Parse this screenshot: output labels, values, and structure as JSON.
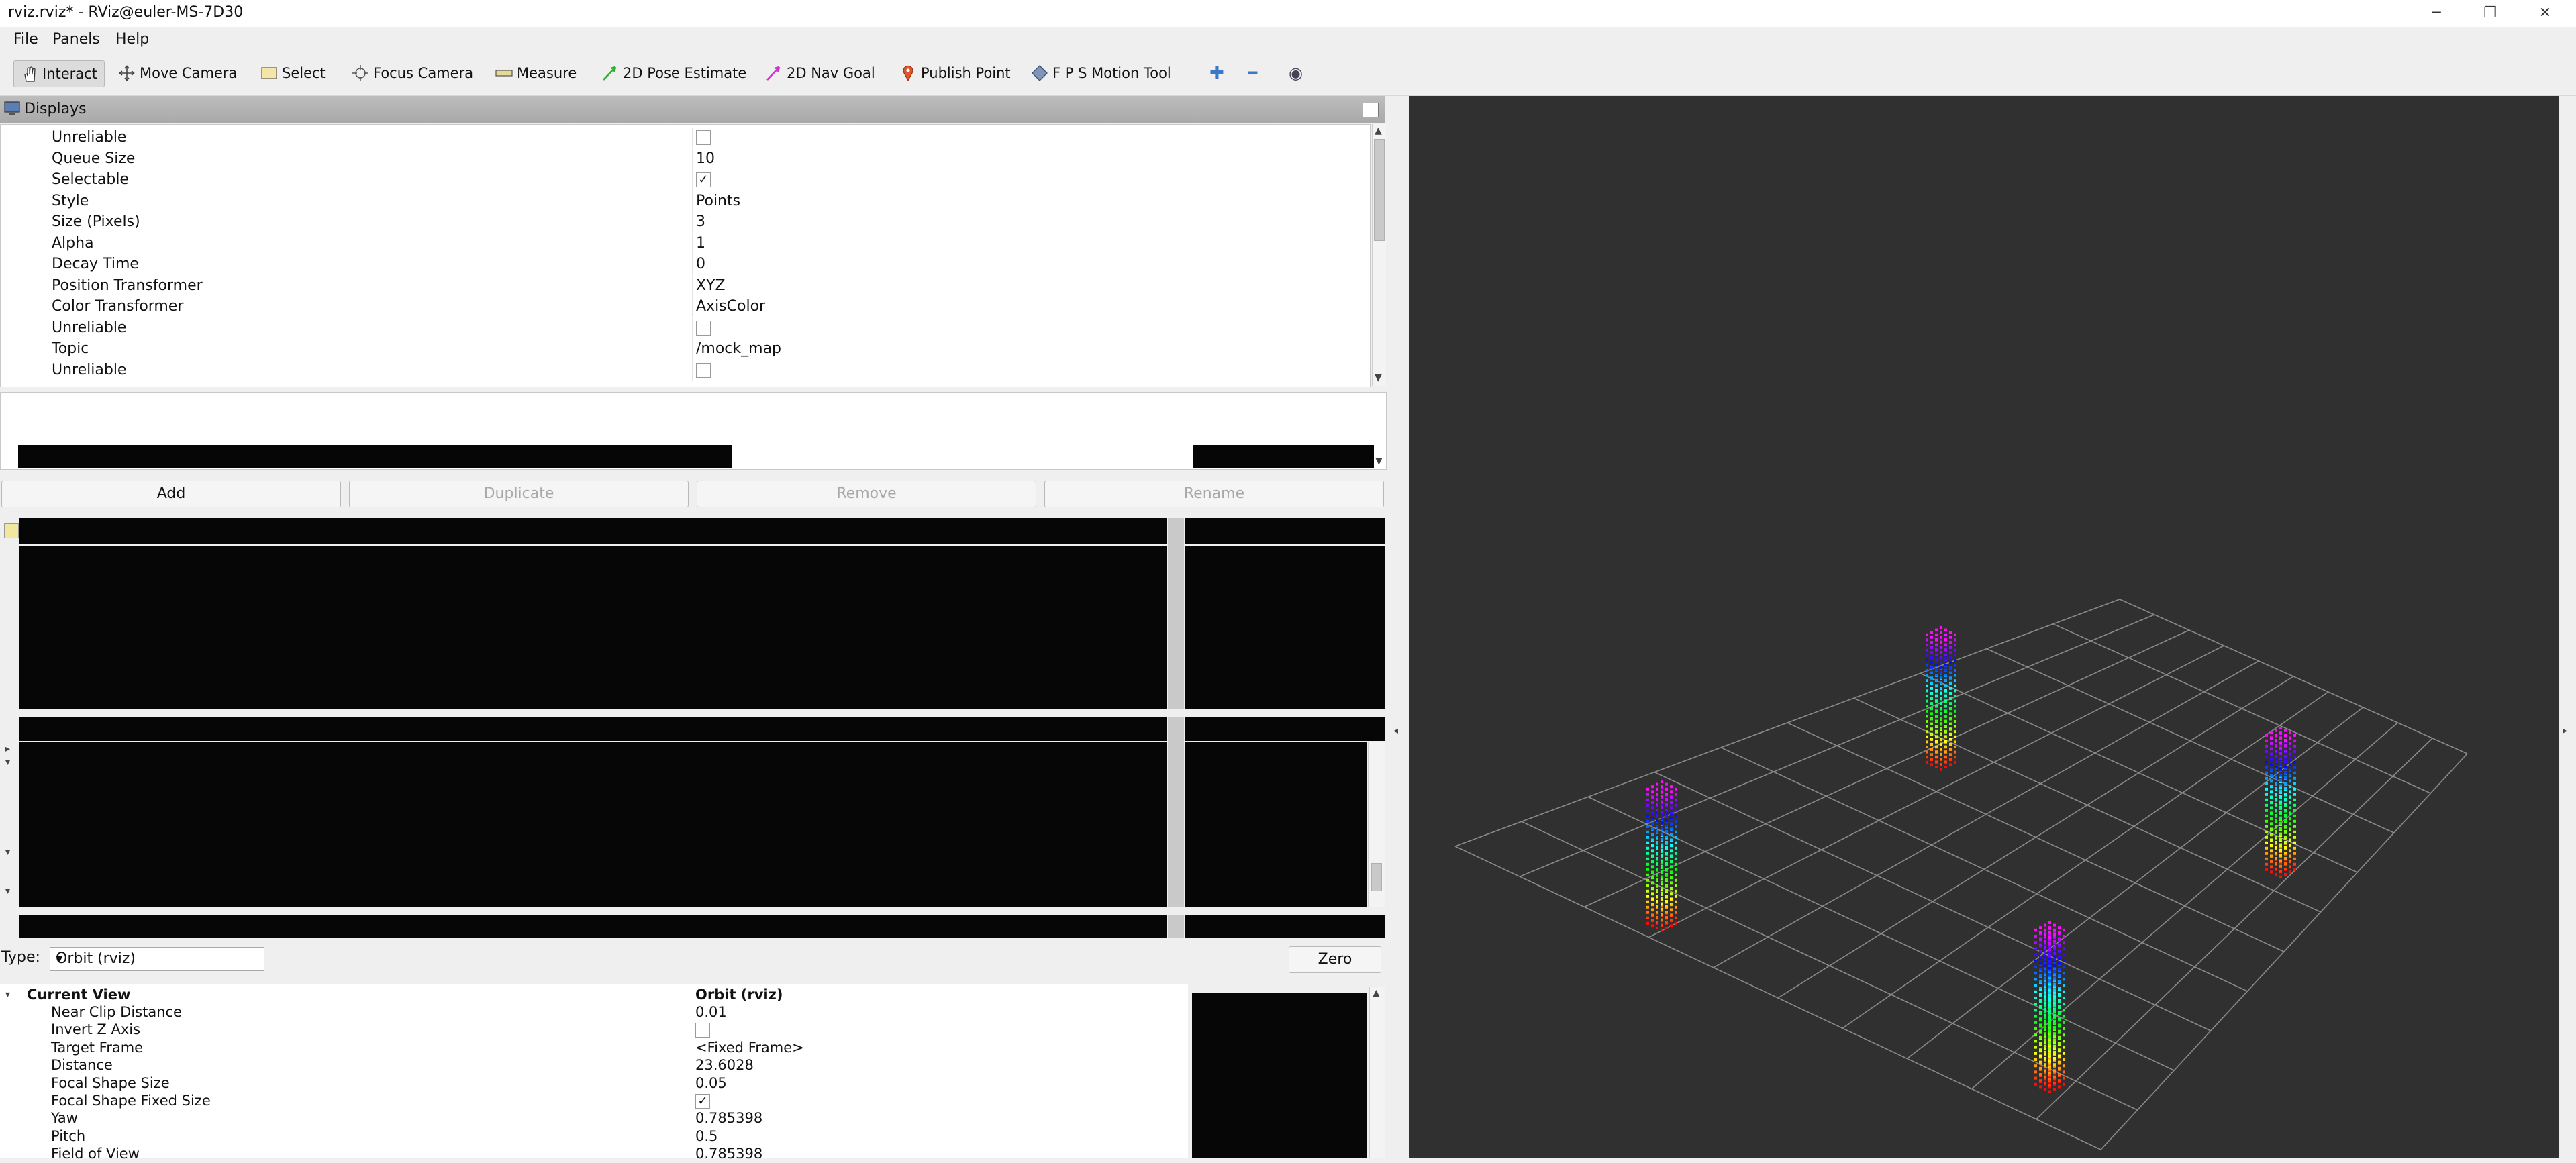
{
  "window": {
    "title": "rviz.rviz* - RViz@euler-MS-7D30",
    "minimize_glyph": "─",
    "restore_glyph": "❐",
    "close_glyph": "✕"
  },
  "menu": [
    "File",
    "Panels",
    "Help"
  ],
  "toolbar": {
    "tools": [
      "Interact",
      "Move Camera",
      "Select",
      "Focus Camera",
      "Measure",
      "2D Pose Estimate",
      "2D Nav Goal",
      "Publish Point",
      "F P S Motion Tool"
    ],
    "add_glyph": "✚",
    "remove_glyph": "━",
    "eye_glyph": "◉"
  },
  "displays": {
    "title": "Displays",
    "rows": [
      {
        "key": "Unreliable",
        "value": "",
        "checkbox": true,
        "checked": false
      },
      {
        "key": "Queue Size",
        "value": "10"
      },
      {
        "key": "Selectable",
        "value": "",
        "checkbox": true,
        "checked": true
      },
      {
        "key": "Style",
        "value": "Points"
      },
      {
        "key": "Size (Pixels)",
        "value": "3"
      },
      {
        "key": "Alpha",
        "value": "1"
      },
      {
        "key": "Decay Time",
        "value": "0"
      },
      {
        "key": "Position Transformer",
        "value": "XYZ"
      },
      {
        "key": "Color Transformer",
        "value": "AxisColor"
      },
      {
        "key": "Unreliable",
        "value": "",
        "checkbox": true,
        "checked": false
      },
      {
        "key": "Topic",
        "value": "/mock_map"
      },
      {
        "key": "Unreliable",
        "value": "",
        "checkbox": true,
        "checked": false
      }
    ],
    "buttons": {
      "add": "Add",
      "duplicate": "Duplicate",
      "remove": "Remove",
      "rename": "Rename"
    }
  },
  "views": {
    "type_label": "Type:",
    "type_value": "Orbit (rviz)",
    "zero_label": "Zero",
    "current_view_label": "Current View",
    "current_view_value": "Orbit (rviz)",
    "rows": [
      {
        "key": "Near Clip Distance",
        "value": "0.01"
      },
      {
        "key": "Invert Z Axis",
        "value": "",
        "checkbox": true,
        "checked": false
      },
      {
        "key": "Target Frame",
        "value": "<Fixed Frame>"
      },
      {
        "key": "Distance",
        "value": "23.6028"
      },
      {
        "key": "Focal Shape Size",
        "value": "0.05"
      },
      {
        "key": "Focal Shape Fixed Size",
        "value": "",
        "checkbox": true,
        "checked": true
      },
      {
        "key": "Yaw",
        "value": "0.785398"
      },
      {
        "key": "Pitch",
        "value": "0.5"
      },
      {
        "key": "Field of View",
        "value": "0.785398"
      }
    ]
  },
  "icons": {
    "check": "✓",
    "expand": "▾",
    "combo_arrow": "▼",
    "scroll_up": "▲",
    "scroll_down": "▼",
    "collapse_left": "◂",
    "collapse_right": "▸"
  }
}
